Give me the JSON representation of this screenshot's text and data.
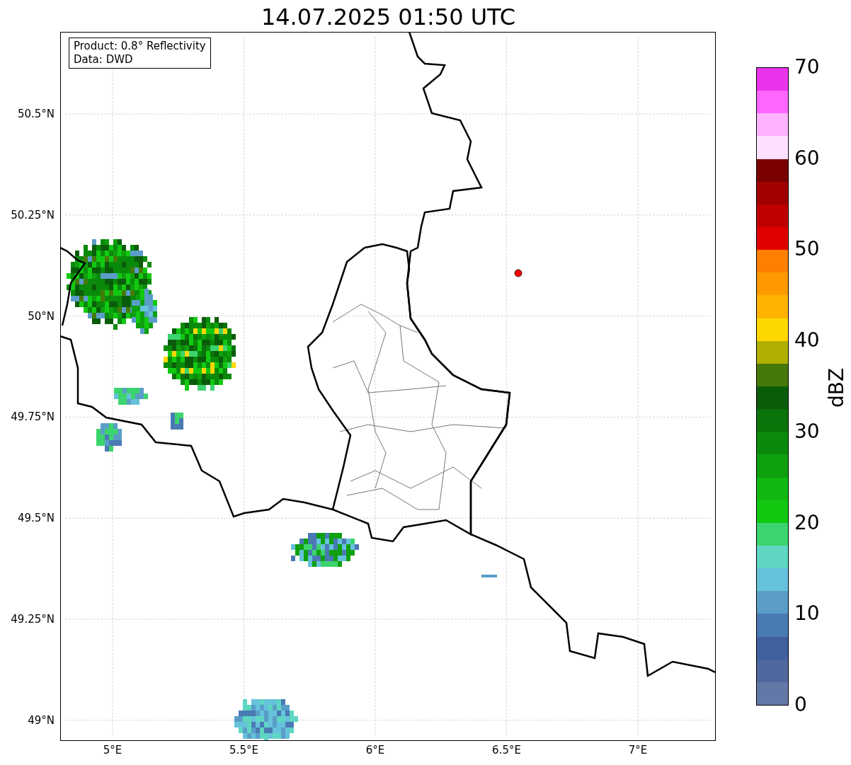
{
  "title": "14.07.2025 01:50 UTC",
  "legend": [
    "Product: 0.8° Reflectivity",
    "Data: DWD"
  ],
  "axes": {
    "yticks": [
      "50.5°N",
      "50.25°N",
      "50°N",
      "49.75°N",
      "49.5°N",
      "49.25°N",
      "49°N"
    ],
    "xticks": [
      "5°E",
      "5.5°E",
      "6°E",
      "6.5°E",
      "7°E"
    ]
  },
  "colorbar": {
    "label": "dBZ",
    "ticks": [
      "70",
      "60",
      "50",
      "40",
      "30",
      "20",
      "10",
      "0"
    ],
    "segments": [
      {
        "color": "#ea33ea"
      },
      {
        "color": "#ff66ff"
      },
      {
        "color": "#ffb3ff"
      },
      {
        "color": "#ffdfff"
      },
      {
        "color": "#7a0000"
      },
      {
        "color": "#a00000"
      },
      {
        "color": "#c00000"
      },
      {
        "color": "#e00000"
      },
      {
        "color": "#ff7f00"
      },
      {
        "color": "#ff9900"
      },
      {
        "color": "#ffb300"
      },
      {
        "color": "#ffd700"
      },
      {
        "color": "#b0b000"
      },
      {
        "color": "#457a0a"
      },
      {
        "color": "#0a5c0a"
      },
      {
        "color": "#0a730a"
      },
      {
        "color": "#0a8a0a"
      },
      {
        "color": "#0fa00f"
      },
      {
        "color": "#10b810"
      },
      {
        "color": "#12c912"
      },
      {
        "color": "#3cd46e"
      },
      {
        "color": "#5ed6c2"
      },
      {
        "color": "#66c2db"
      },
      {
        "color": "#5a9ec8"
      },
      {
        "color": "#4a7ab4"
      },
      {
        "color": "#4060a0"
      },
      {
        "color": "#5068a0"
      },
      {
        "color": "#6478a8"
      }
    ]
  }
}
